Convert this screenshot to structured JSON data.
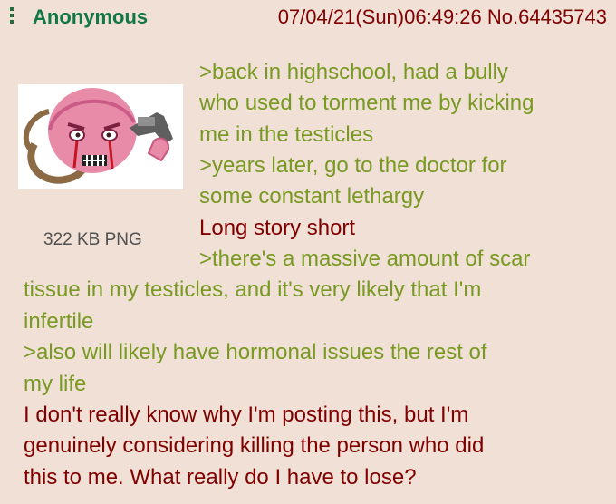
{
  "post": {
    "name": "Anonymous",
    "datetime_id": "07/04/21(Sun)06:49:26 No.64435743",
    "file_info": "322 KB PNG",
    "lines": [
      ">back in highschool, had a bully",
      "who used to torment me by kicking",
      "me in the testicles",
      ">years later, go to the doctor for",
      "some constant lethargy",
      "Long story short",
      ">there's a massive amount of scar",
      "tissue in my testicles, and it's very likely that I'm",
      "infertile",
      ">also will likely have hormonal issues the rest of",
      "my life",
      "I don't really know why I'm posting this, but I'm",
      "genuinely considering killing the person who did",
      "this to me. What really do I have to lose?"
    ]
  },
  "colors": {
    "background": "#f0e0d6",
    "name": "#117743",
    "greentext": "#789922",
    "text": "#800000"
  },
  "icons": {
    "menu": "post-menu-icon",
    "thumbnail": "pink-wojak-with-revolver-thumbnail"
  }
}
